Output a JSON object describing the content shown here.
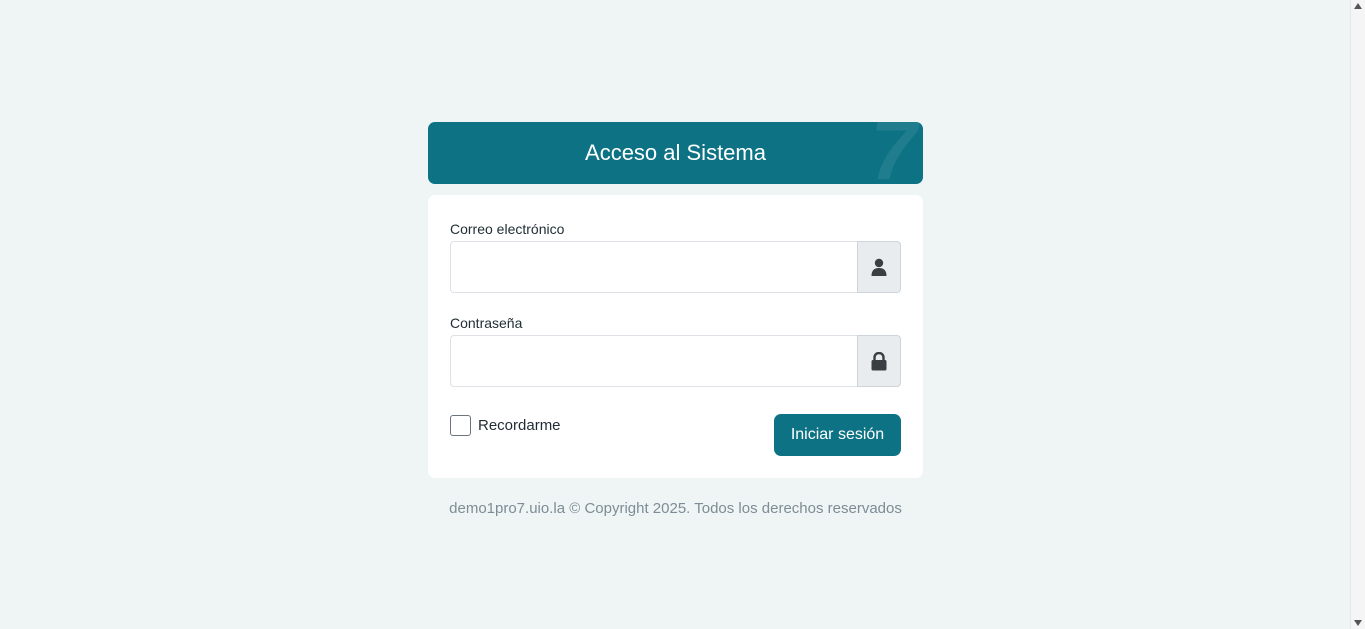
{
  "header": {
    "title": "Acceso al Sistema",
    "watermark": "7"
  },
  "form": {
    "email_label": "Correo electrónico",
    "email_value": "",
    "email_icon": "user-icon",
    "password_label": "Contraseña",
    "password_value": "",
    "password_icon": "lock-icon",
    "remember_label": "Recordarme",
    "remember_checked": false,
    "submit_label": "Iniciar sesión"
  },
  "footer": {
    "text": "demo1pro7.uio.la © Copyright 2025. Todos los derechos reservados"
  },
  "colors": {
    "brand": "#0d7284",
    "background": "#eef5f4",
    "footer_text": "#7d8c97"
  }
}
